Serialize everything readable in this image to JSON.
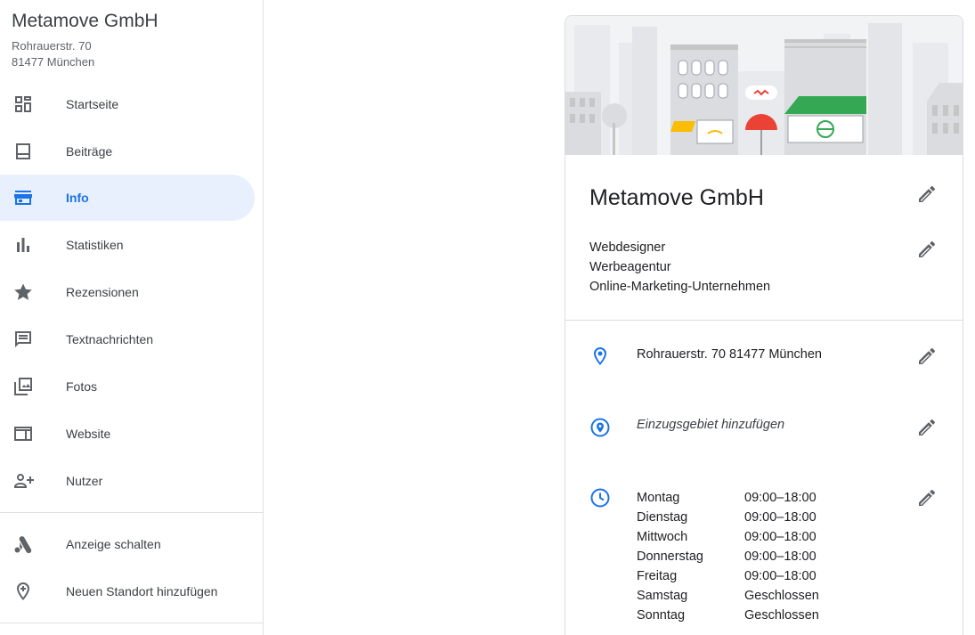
{
  "business": {
    "name": "Metamove GmbH",
    "address_line1": "Rohrauerstr. 70",
    "address_line2": "81477 München"
  },
  "nav": {
    "items": [
      {
        "label": "Startseite",
        "icon": "dashboard-icon"
      },
      {
        "label": "Beiträge",
        "icon": "posts-icon"
      },
      {
        "label": "Info",
        "icon": "storefront-icon",
        "active": true
      },
      {
        "label": "Statistiken",
        "icon": "bar-chart-icon"
      },
      {
        "label": "Rezensionen",
        "icon": "star-icon"
      },
      {
        "label": "Textnachrichten",
        "icon": "message-icon"
      },
      {
        "label": "Fotos",
        "icon": "photos-icon"
      },
      {
        "label": "Website",
        "icon": "website-icon"
      },
      {
        "label": "Nutzer",
        "icon": "add-person-icon"
      }
    ],
    "secondary": [
      {
        "label": "Anzeige schalten",
        "icon": "google-ads-icon"
      },
      {
        "label": "Neuen Standort hinzufügen",
        "icon": "add-location-icon"
      }
    ]
  },
  "card": {
    "title": "Metamove GmbH",
    "categories": [
      "Webdesigner",
      "Werbeagentur",
      "Online-Marketing-Unternehmen"
    ],
    "address": "Rohrauerstr. 70 81477 München",
    "service_area": "Einzugsgebiet hinzufügen",
    "hours": [
      {
        "day": "Montag",
        "time": "09:00–18:00"
      },
      {
        "day": "Dienstag",
        "time": "09:00–18:00"
      },
      {
        "day": "Mittwoch",
        "time": "09:00–18:00"
      },
      {
        "day": "Donnerstag",
        "time": "09:00–18:00"
      },
      {
        "day": "Freitag",
        "time": "09:00–18:00"
      },
      {
        "day": "Samstag",
        "time": "Geschlossen"
      },
      {
        "day": "Sonntag",
        "time": "Geschlossen"
      }
    ]
  },
  "colors": {
    "accent": "#1a73e8",
    "active_bg": "#e8f0fe",
    "icon_gray": "#5f6368",
    "awning_green": "#34a853",
    "awning_red": "#ea4335",
    "awning_yellow": "#fbbc04"
  }
}
